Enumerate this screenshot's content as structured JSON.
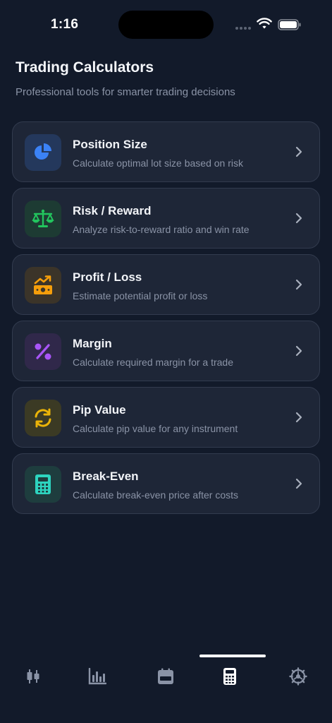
{
  "status_bar": {
    "time": "1:16"
  },
  "header": {
    "title": "Trading Calculators",
    "subtitle": "Professional tools for smarter trading decisions"
  },
  "calculators": [
    {
      "name": "Position Size",
      "description": "Calculate optimal lot size based on risk",
      "icon": "pie-chart-icon",
      "color": "#3b82f6",
      "bg": "#24385c"
    },
    {
      "name": "Risk / Reward",
      "description": "Analyze risk-to-reward ratio and win rate",
      "icon": "scale-icon",
      "color": "#22c55e",
      "bg": "#1d3b33"
    },
    {
      "name": "Profit / Loss",
      "description": "Estimate potential profit or loss",
      "icon": "money-trend-icon",
      "color": "#f59e0b",
      "bg": "#3b3429"
    },
    {
      "name": "Margin",
      "description": "Calculate required margin for a trade",
      "icon": "percent-icon",
      "color": "#a855f7",
      "bg": "#30284a"
    },
    {
      "name": "Pip Value",
      "description": "Calculate pip value for any instrument",
      "icon": "refresh-icon",
      "color": "#eab308",
      "bg": "#3b3a24"
    },
    {
      "name": "Break-Even",
      "description": "Calculate break-even price after costs",
      "icon": "calculator-icon",
      "color": "#2dd4bf",
      "bg": "#1e3d3e"
    }
  ],
  "tabs": [
    {
      "icon": "candlestick-icon",
      "active": false
    },
    {
      "icon": "bar-chart-icon",
      "active": false
    },
    {
      "icon": "calendar-icon",
      "active": false
    },
    {
      "icon": "calculator-icon",
      "active": true
    },
    {
      "icon": "settings-icon",
      "active": false
    }
  ],
  "colors": {
    "background": "#121a2a",
    "card": "#1e2637",
    "tab_active": "#ffffff",
    "tab_inactive": "#8a93a6"
  }
}
